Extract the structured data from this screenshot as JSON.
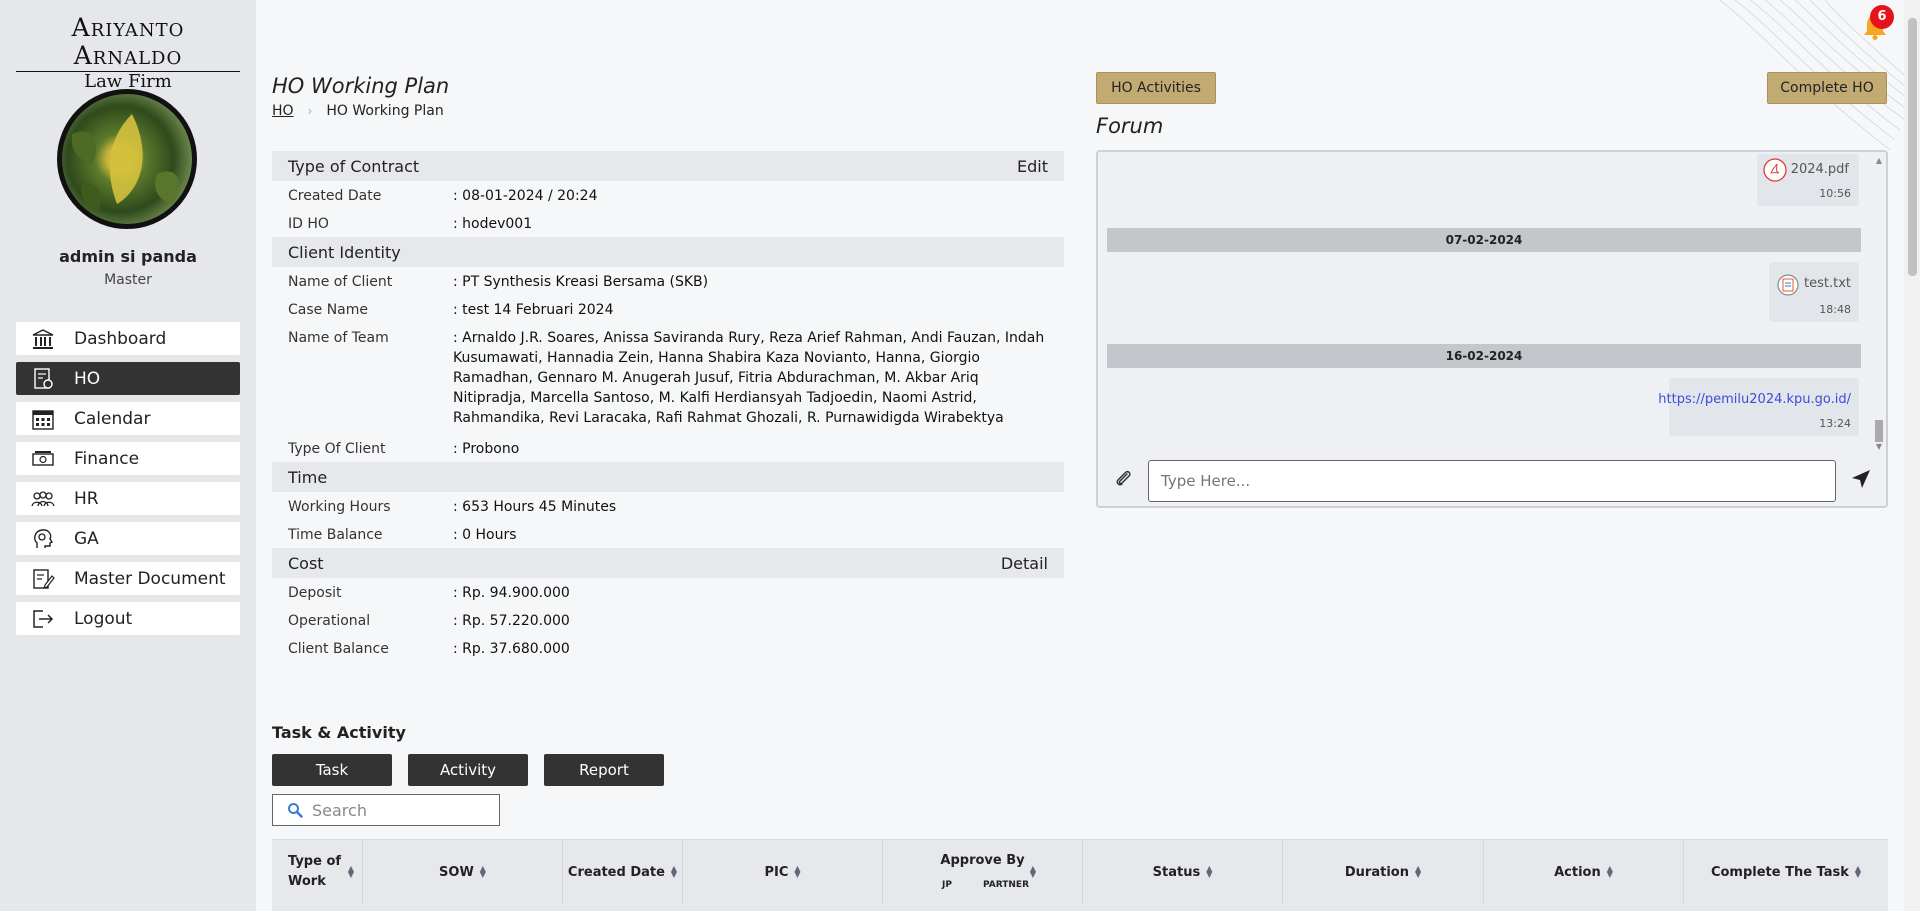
{
  "brand": {
    "line1": "Ariyanto Arnaldo",
    "line2": "Law Firm"
  },
  "user": {
    "name": "admin si panda",
    "role": "Master"
  },
  "sidebar": {
    "items": [
      {
        "label": "Dashboard",
        "icon": "bank-icon",
        "active": false
      },
      {
        "label": "HO",
        "icon": "document-gear-icon",
        "active": true
      },
      {
        "label": "Calendar",
        "icon": "calendar-icon",
        "active": false
      },
      {
        "label": "Finance",
        "icon": "cash-icon",
        "active": false
      },
      {
        "label": "HR",
        "icon": "people-icon",
        "active": false
      },
      {
        "label": "GA",
        "icon": "head-gear-icon",
        "active": false
      },
      {
        "label": "Master Document",
        "icon": "document-edit-icon",
        "active": false
      },
      {
        "label": "Logout",
        "icon": "logout-icon",
        "active": false
      }
    ]
  },
  "page": {
    "title": "HO Working Plan",
    "breadcrumb": {
      "root": "HO",
      "sep": "›",
      "current": "HO Working Plan"
    }
  },
  "info": {
    "contract": {
      "heading": "Type of Contract",
      "action": "Edit",
      "rows": [
        {
          "label": "Created Date",
          "value": ": 08-01-2024 / 20:24"
        },
        {
          "label": "ID HO",
          "value": ": hodev001"
        }
      ]
    },
    "client": {
      "heading": "Client Identity",
      "rows": [
        {
          "label": "Name of Client",
          "value": ": PT Synthesis Kreasi Bersama (SKB)"
        },
        {
          "label": "Case Name",
          "value": ": test 14 Februari 2024"
        },
        {
          "label": "Name of Team",
          "value": ": Arnaldo J.R. Soares, Anissa Saviranda Rury, Reza Arief Rahman, Andi Fauzan, Indah Kusumawati, Hannadia Zein, Hanna Shabira Kaza Novianto, Hanna, Giorgio Ramadhan, Gennaro M. Anugerah Jusuf, Fitria Abdurachman, M. Akbar Ariq Nitipradja, Marcella Santoso, M. Kalfi Herdiansyah Tadjoedin, Naomi Astrid, Rahmandika, Revi Laracaka, Rafi Rahmat Ghozali, R. Purnawidigda Wirabektya"
        },
        {
          "label": "Type Of Client",
          "value": ": Probono"
        }
      ]
    },
    "time": {
      "heading": "Time",
      "rows": [
        {
          "label": "Working Hours",
          "value": ": 653 Hours 45 Minutes"
        },
        {
          "label": "Time Balance",
          "value": ": 0 Hours"
        }
      ]
    },
    "cost": {
      "heading": "Cost",
      "action": "Detail",
      "rows": [
        {
          "label": "Deposit",
          "value": ": Rp. 94.900.000"
        },
        {
          "label": "Operational",
          "value": ": Rp. 57.220.000"
        },
        {
          "label": "Client Balance",
          "value": ": Rp. 37.680.000"
        }
      ]
    }
  },
  "actions": {
    "ho_activities": "HO Activities",
    "complete_ho": "Complete HO"
  },
  "forum": {
    "title": "Forum",
    "messages": [
      {
        "type": "file",
        "icon": "pdf-icon",
        "name": "2024.pdf",
        "time": "10:56"
      },
      {
        "type": "date",
        "text": "07-02-2024"
      },
      {
        "type": "file",
        "icon": "text-file-icon",
        "name": "test.txt",
        "time": "18:48"
      },
      {
        "type": "date",
        "text": "16-02-2024"
      },
      {
        "type": "link",
        "text": "https://pemilu2024.kpu.go.id/",
        "time": "13:24"
      }
    ],
    "input_placeholder": "Type Here..."
  },
  "tasks": {
    "title": "Task & Activity",
    "buttons": [
      "Task",
      "Activity",
      "Report"
    ],
    "search_placeholder": "Search",
    "columns": [
      {
        "label": "Type of Work"
      },
      {
        "label": "SOW"
      },
      {
        "label": "Created Date"
      },
      {
        "label": "PIC"
      },
      {
        "label": "Approve By",
        "sub": [
          "JP",
          "PARTNER"
        ]
      },
      {
        "label": "Status"
      },
      {
        "label": "Duration"
      },
      {
        "label": "Action"
      },
      {
        "label": "Complete The Task"
      }
    ]
  },
  "notifications": {
    "count": "6"
  },
  "colors": {
    "accent_gold": "#c2ab72",
    "active_nav": "#333333",
    "badge": "#e5141a",
    "link": "#3b4fd8"
  }
}
